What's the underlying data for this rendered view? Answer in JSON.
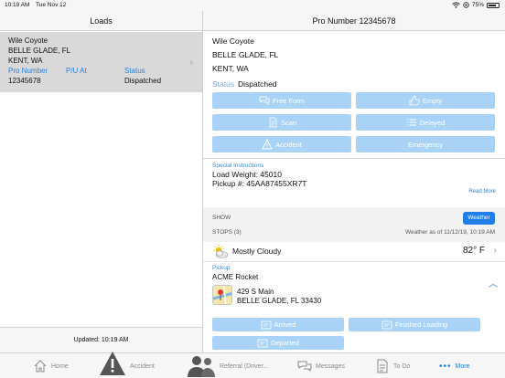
{
  "status_bar": {
    "time": "10:19 AM",
    "date": "Tue Nov 12",
    "battery": "75%"
  },
  "left": {
    "title": "Loads",
    "load": {
      "name": "Wile Coyote",
      "origin": "BELLE GLADE, FL",
      "destination": "KENT, WA",
      "pro_label": "Pro Number",
      "pu_label": "P/U At",
      "status_label": "Status",
      "pro_value": "12345678",
      "status_value": "Dispatched"
    },
    "updated": "Updated: 10:19 AM"
  },
  "right": {
    "title": "Pro Number 12345678",
    "name": "Wile Coyote",
    "origin": "BELLE GLADE, FL",
    "destination": "KENT, WA",
    "status_label": "Status",
    "status_value": "Dispatched",
    "actions": {
      "free_form": "Free Form",
      "empty": "Empty",
      "scan": "Scan",
      "delayed": "Delayed",
      "accident": "Accident",
      "emergency": "Emergency"
    },
    "special": {
      "label": "Special Instructions",
      "line1": "Load Weight: 45010",
      "line2": "Pickup #: 45AA87455XR7T",
      "read_more": "Read More"
    },
    "show_label": "SHOW",
    "weather_button": "Weather",
    "stops_label": "STOPS (3)",
    "weather_asof": "Weather as of 11/12/19, 10:19 AM",
    "weather": {
      "condition": "Mostly Cloudy",
      "temp": "82° F"
    },
    "pickup": {
      "label": "Pickup",
      "name": "ACME Rocket",
      "address1": "429 S Main",
      "address2": "BELLE GLADE, FL 33430"
    },
    "stop_actions": {
      "arrived": "Arrived",
      "finished_loading": "Finished Loading",
      "departed": "Departed"
    }
  },
  "tabs": {
    "home": "Home",
    "accident": "Accident",
    "referral": "Referral (Driver...",
    "messages": "Messages",
    "todo": "To Do",
    "more": "More"
  },
  "colors": {
    "accent": "#1f7ee8",
    "button_bg": "#a9d2f7",
    "selected_row": "#d9d9d9",
    "label_blue": "#3d86d8"
  }
}
